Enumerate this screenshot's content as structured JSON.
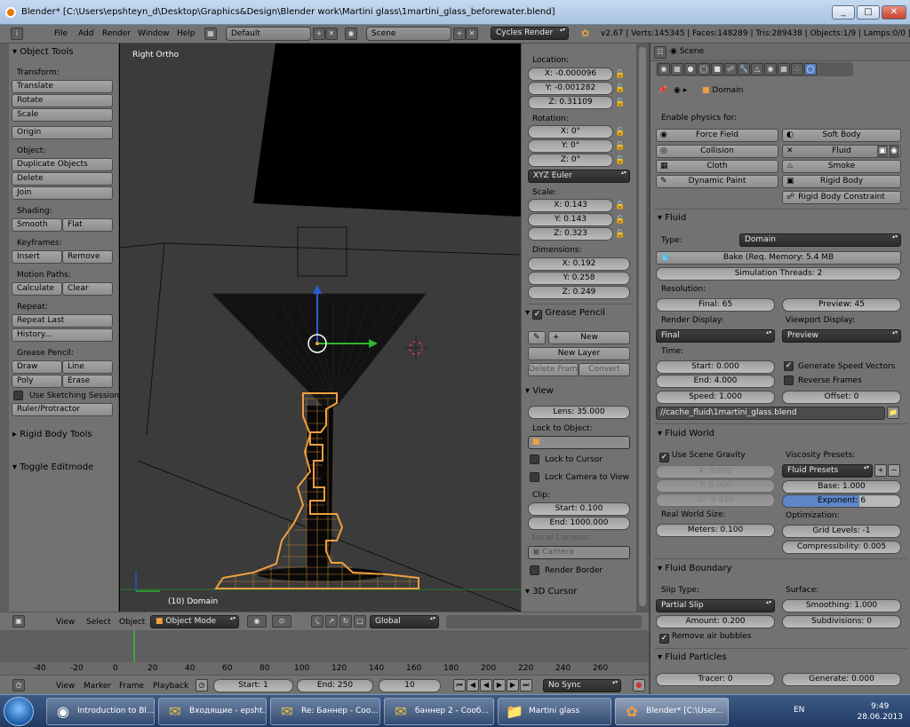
{
  "window": {
    "title": "Blender* [C:\\Users\\epshteyn_d\\Desktop\\Graphics&Design\\Blender work\\Martini glass\\1martini_glass_beforewater.blend]",
    "min": "_",
    "max": "□",
    "close": "✕"
  },
  "infobar": {
    "menus": [
      "File",
      "Add",
      "Render",
      "Window",
      "Help"
    ],
    "layout": "Default",
    "scene": "Scene",
    "engine": "Cycles Render",
    "stats": "v2.67 | Verts:145345 | Faces:148289 | Tris:289438 | Objects:1/9 | Lamps:0/0 | Mem"
  },
  "toolshelf": {
    "header": "Object Tools",
    "transform_label": "Transform:",
    "translate": "Translate",
    "rotate": "Rotate",
    "scale": "Scale",
    "origin": "Origin",
    "object_label": "Object:",
    "duplicate": "Duplicate Objects",
    "delete": "Delete",
    "join": "Join",
    "shading_label": "Shading:",
    "smooth": "Smooth",
    "flat": "Flat",
    "keyframes_label": "Keyframes:",
    "insert": "Insert",
    "remove": "Remove",
    "motion_label": "Motion Paths:",
    "calculate": "Calculate",
    "clear": "Clear",
    "repeat_label": "Repeat:",
    "repeat_last": "Repeat Last",
    "history": "History...",
    "gp_label": "Grease Pencil:",
    "draw": "Draw",
    "line": "Line",
    "poly": "Poly",
    "erase": "Erase",
    "sketch": "Use Sketching Sessions",
    "ruler": "Ruler/Protractor",
    "rigid_tools": "Rigid Body Tools",
    "toggle_edit": "Toggle Editmode"
  },
  "viewport": {
    "view_name": "Right Ortho",
    "object_info": "(10) Domain"
  },
  "nprops": {
    "location_label": "Location:",
    "loc_x": "X: -0.000096",
    "loc_y": "Y: -0.001282",
    "loc_z": "Z: 0.31109",
    "rotation_label": "Rotation:",
    "rot_x": "X: 0°",
    "rot_y": "Y: 0°",
    "rot_z": "Z: 0°",
    "rot_mode": "XYZ Euler",
    "scale_label": "Scale:",
    "sc_x": "X: 0.143",
    "sc_y": "Y: 0.143",
    "sc_z": "Z: 0.323",
    "dims_label": "Dimensions:",
    "dim_x": "X: 0.192",
    "dim_y": "Y: 0.258",
    "dim_z": "Z: 0.249",
    "gp_header": "Grease Pencil",
    "new": "New",
    "new_layer": "New Layer",
    "delete_frame": "Delete Frame",
    "convert": "Convert",
    "view_header": "View",
    "lens": "Lens: 35.000",
    "lock_obj_label": "Lock to Object:",
    "lock_cursor": "Lock to Cursor",
    "lock_camera": "Lock Camera to View",
    "clip_label": "Clip:",
    "clip_start": "Start: 0.100",
    "clip_end": "End: 1000.000",
    "local_cam_label": "Local Camera:",
    "camera": "Camera",
    "render_border": "Render Border",
    "cursor_header": "3D Cursor"
  },
  "view3d_header": {
    "view": "View",
    "select": "Select",
    "object": "Object",
    "mode": "Object Mode",
    "orientation": "Global"
  },
  "timeline": {
    "ticks": [
      "-40",
      "-20",
      "0",
      "20",
      "40",
      "60",
      "80",
      "100",
      "120",
      "140",
      "160",
      "180",
      "200",
      "220",
      "240",
      "260"
    ],
    "current_frame_marker": "10",
    "view": "View",
    "marker": "Marker",
    "frame": "Frame",
    "playback": "Playback",
    "start": "Start: 1",
    "end": "End: 250",
    "current": "10",
    "sync": "No Sync"
  },
  "props": {
    "scene_tab": "Scene",
    "context": "Domain",
    "enable_physics": "Enable physics for:",
    "force_field": "Force Field",
    "soft_body": "Soft Body",
    "collision": "Collision",
    "fluid_btn": "Fluid",
    "cloth": "Cloth",
    "smoke": "Smoke",
    "dynamic_paint": "Dynamic Paint",
    "rigid_body": "Rigid Body",
    "rigid_body_constraint": "Rigid Body Constraint",
    "fluid_header": "Fluid",
    "type_label": "Type:",
    "type_value": "Domain",
    "bake": "Bake (Req. Memory: 5.4 MB",
    "threads": "Simulation Threads: 2",
    "resolution_label": "Resolution:",
    "final": "Final: 65",
    "preview": "Preview: 45",
    "render_display_label": "Render Display:",
    "viewport_display_label": "Viewport Display:",
    "render_display": "Final",
    "viewport_display": "Preview",
    "time_label": "Time:",
    "start": "Start: 0.000",
    "end": "End: 4.000",
    "speed": "Speed: 1.000",
    "gen_speed": "Generate Speed Vectors",
    "reverse": "Reverse Frames",
    "offset": "Offset: 0",
    "cache_path": "//cache_fluid\\1martini_glass.blend",
    "world_header": "Fluid World",
    "use_gravity": "Use Scene Gravity",
    "gx": "X: 0.000",
    "gy": "Y: 0.000",
    "gz": "Z: -9.810",
    "viscosity_label": "Viscosity Presets:",
    "fluid_presets": "Fluid Presets",
    "base": "Base: 1.000",
    "exponent": "Exponent: 6",
    "real_size_label": "Real World Size:",
    "meters": "Meters: 0.100",
    "optimization_label": "Optimization:",
    "grid_levels": "Grid Levels: -1",
    "compressibility": "Compressibility: 0.005",
    "boundary_header": "Fluid Boundary",
    "slip_label": "Slip Type:",
    "slip_value": "Partial Slip",
    "surface_label": "Surface:",
    "amount": "Amount: 0.200",
    "smoothing": "Smoothing: 1.000",
    "subdivisions": "Subdivisions: 0",
    "remove_bubbles": "Remove air bubbles",
    "particles_header": "Fluid Particles",
    "tracer": "Tracer: 0",
    "generate": "Generate: 0.000"
  },
  "taskbar": {
    "items": [
      "Introduction to Bl...",
      "Входящие - epsht...",
      "Re: Баннер - Соо...",
      "баннер 2 - Сооб...",
      "Martini glass",
      "Blender* [C:\\User..."
    ],
    "lang": "EN",
    "time": "9:49",
    "date": "28.06.2013"
  },
  "colors": {
    "orange": "#f0a040",
    "viewport_bg": "#3b3b3b",
    "panel_bg": "#727272"
  }
}
